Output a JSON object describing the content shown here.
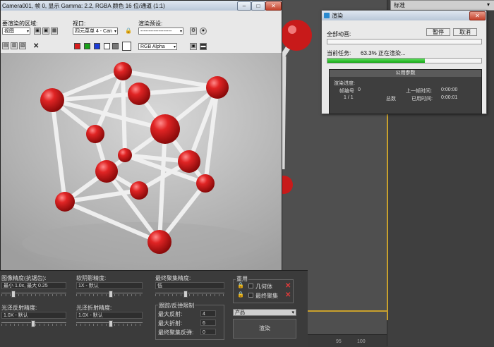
{
  "frame_window": {
    "title": "Camera001, 帧 0, 显示 Gamma: 2.2, RGBA 颜色 16 位/通道 (1:1)",
    "area_label": "要渲染的区域:",
    "area_value": "视图",
    "viewport_label": "视口:",
    "viewport_value": "四元菜单 4 - Can",
    "preset_label": "渲染预设:",
    "preset_value": "-------------------",
    "channel_value": "RGB Alpha"
  },
  "render_dialog": {
    "title": "渲染",
    "all_anim_label": "全部动画:",
    "pause_label": "暂停",
    "cancel_label": "取消",
    "current_task_label": "当前任务:",
    "current_task_status": "63.3% 正在渲染...",
    "all_anim_progress": 0,
    "current_task_progress": 0.633,
    "params_header": "公用参数",
    "render_progress_label": "渲染进度:",
    "frame_number_label": "帧编号",
    "frame_number_value": "0",
    "frame_count": "1 / 1",
    "total_label": "总数",
    "last_frame_time_label": "上一帧时间:",
    "last_frame_time": "0:00:00",
    "elapsed_label": "已用时间:",
    "elapsed_value": "0:00:01"
  },
  "right_panel": {
    "dropdown_value": "标准"
  },
  "settings": {
    "image_precision_label": "图像精度(抗锯齿):",
    "image_precision_value": "最小 1.0x, 最大 0.25",
    "soft_shadow_label": "软阴影精度:",
    "soft_shadow_value": "1X - 默认",
    "final_gather_label": "最终聚集精度:",
    "final_gather_value": "低",
    "glossy_reflect_label": "光泽反射精度:",
    "glossy_reflect_value": "1.0X - 默认",
    "glossy_refract_label": "光泽折射精度:",
    "glossy_refract_value": "1.0X - 默认",
    "reuse_label": "重用",
    "geometry_label": "几何体",
    "final_gather_check_label": "最终聚集",
    "trace_group_label": "跟踪/反弹限制",
    "max_reflect_label": "最大反射:",
    "max_reflect_value": "4",
    "max_refract_label": "最大折射:",
    "max_refract_value": "6",
    "fg_bounce_label": "最终聚集反弹:",
    "fg_bounce_value": "0",
    "product_value": "产品",
    "render_button_label": "渲染"
  },
  "ruler": {
    "tick_a": "95",
    "tick_b": "100"
  },
  "icons": [
    "lock-icon",
    "x-icon",
    "close-icon",
    "minimize-icon",
    "maximize-icon",
    "render-icon"
  ],
  "colors": {
    "progress_green": "#14a814",
    "sphere_red": "#d42020",
    "highlight_frame": "#c9a12c"
  }
}
